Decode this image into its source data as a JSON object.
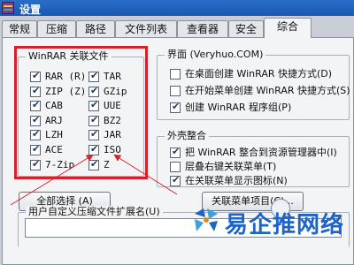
{
  "window": {
    "title": "设置"
  },
  "tabs": [
    {
      "label": "常规"
    },
    {
      "label": "压缩"
    },
    {
      "label": "路径"
    },
    {
      "label": "文件列表"
    },
    {
      "label": "查看器"
    },
    {
      "label": "安全"
    },
    {
      "label": "综合"
    }
  ],
  "assoc": {
    "title": "WinRAR 关联文件",
    "items": [
      {
        "label": "RAR (R)",
        "checked": true
      },
      {
        "label": "TAR",
        "checked": true
      },
      {
        "label": "ZIP (Z)",
        "checked": true
      },
      {
        "label": "GZip",
        "checked": true
      },
      {
        "label": "CAB",
        "checked": true
      },
      {
        "label": "UUE",
        "checked": true
      },
      {
        "label": "ARJ",
        "checked": true
      },
      {
        "label": "BZ2",
        "checked": true
      },
      {
        "label": "LZH",
        "checked": true
      },
      {
        "label": "JAR",
        "checked": true
      },
      {
        "label": "ACE",
        "checked": true
      },
      {
        "label": "ISO",
        "checked": true
      },
      {
        "label": "7-Zip",
        "checked": true
      },
      {
        "label": "Z",
        "checked": true
      }
    ],
    "select_all_label": "全部选择 (A)"
  },
  "interface": {
    "title": "界面 (Veryhuo.COM)",
    "items": [
      {
        "label": "在桌面创建 WinRAR 快捷方式(D)",
        "checked": false
      },
      {
        "label": "在开始菜单创建 WinRAR 快捷方式(S)",
        "checked": false
      },
      {
        "label": "创建 WinRAR 程序组(P)",
        "checked": true
      }
    ]
  },
  "shell": {
    "title": "外壳整合",
    "items": [
      {
        "label": "把 WinRAR 整合到资源管理器中(I)",
        "checked": true
      },
      {
        "label": "层叠右键关联菜单(T)",
        "checked": false
      },
      {
        "label": "在关联菜单显示图标(N)",
        "checked": true
      }
    ],
    "context_menu_button": "关联菜单项目(C)..."
  },
  "custom_ext": {
    "title": "用户自定义压缩文件扩展名(U)",
    "value": ""
  },
  "watermark": {
    "text": "易企推网络"
  },
  "colors": {
    "highlight": "#d6212c",
    "title_bar": "#2a6ec9",
    "watermark": "#1e64c8"
  }
}
